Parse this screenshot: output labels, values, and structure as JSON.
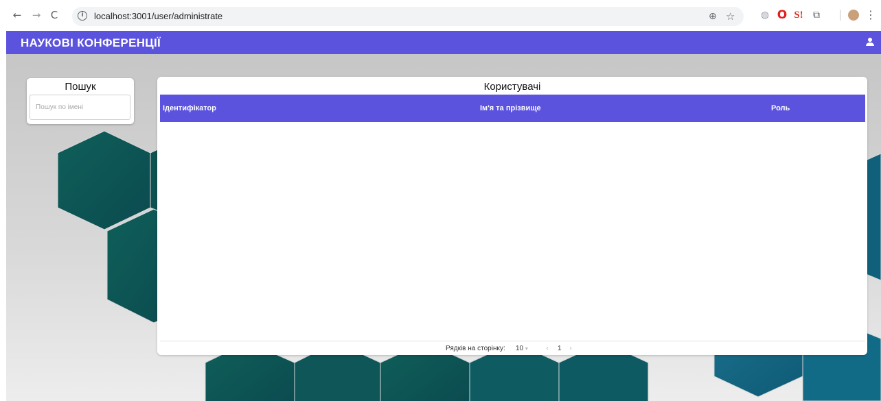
{
  "browser": {
    "url": "localhost:3001/user/administrate",
    "back_icon": "←",
    "forward_icon": "→",
    "reload_icon": "C",
    "info_icon": "i",
    "zoom_icon": "🔍",
    "star_icon": "☆",
    "extensions": [
      "globe-extension",
      "opera-extension",
      "s-extension",
      "puzzle-extension",
      "profile-avatar",
      "menu-dots"
    ]
  },
  "app": {
    "title": "НАУКОВІ КОНФЕРЕНЦІЇ",
    "accent_color": "#5b52de"
  },
  "search": {
    "title": "Пошук",
    "placeholder": "Пошук по імені",
    "value": ""
  },
  "users": {
    "title": "Користувачі",
    "columns": [
      "Ідентифікатор",
      "Ім'я та прізвище",
      "Роль"
    ],
    "rows": [],
    "pagination": {
      "rows_label": "Рядків на сторінку:",
      "rows_per_page": "10",
      "page": "1"
    }
  }
}
